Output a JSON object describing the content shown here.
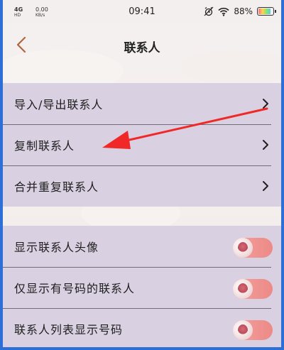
{
  "status_bar": {
    "network_top": "4G",
    "network_bottom": "HD",
    "rate_top": "0.00",
    "rate_bottom": "KB/s",
    "time": "09:41",
    "battery_percent": "88%",
    "battery_level": 0.88,
    "icons": [
      "signal-icon",
      "alarm-icon",
      "wifi-icon",
      "battery-icon"
    ]
  },
  "nav": {
    "title": "联系人",
    "back_icon": "chevron-left-icon"
  },
  "group1": {
    "items": [
      {
        "label": "导入/导出联系人",
        "icon": "chevron-right-icon"
      },
      {
        "label": "复制联系人",
        "icon": "chevron-right-icon"
      },
      {
        "label": "合并重复联系人",
        "icon": "chevron-right-icon"
      }
    ]
  },
  "group2": {
    "items": [
      {
        "label": "显示联系人头像",
        "toggle": "on"
      },
      {
        "label": "仅显示有号码的联系人",
        "toggle": "on"
      },
      {
        "label": "联系人列表显示号码",
        "toggle": "on"
      }
    ]
  },
  "colors": {
    "accent_back": "#b0663c",
    "group_bg": "#d9d1e1",
    "toggle_on": "#ec8a86",
    "annotation_arrow": "#f02828",
    "frame": "#2d6fd6"
  }
}
